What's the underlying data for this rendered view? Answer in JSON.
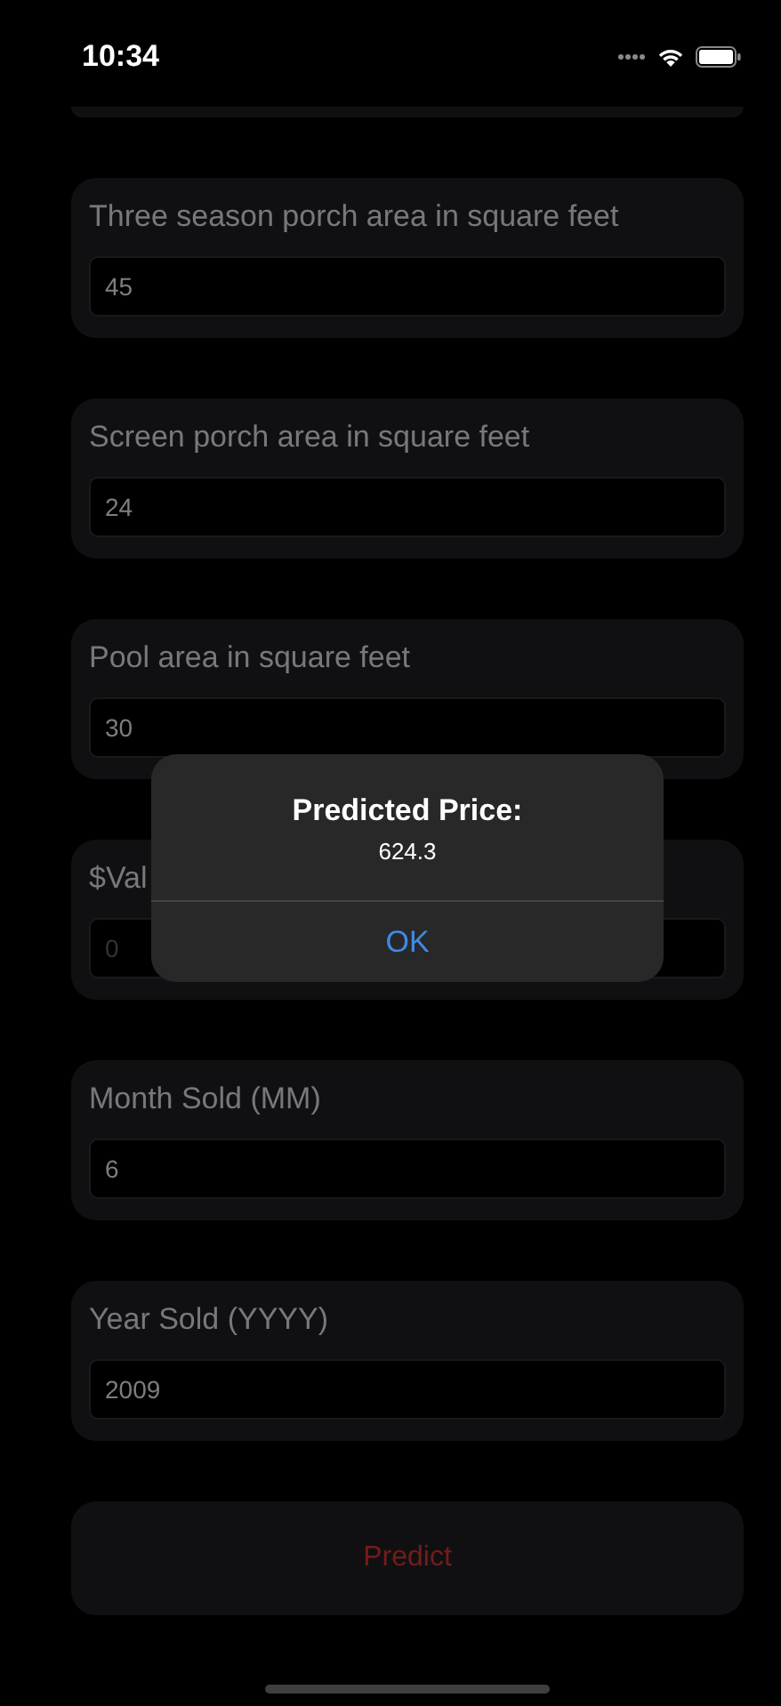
{
  "status_bar": {
    "time": "10:34"
  },
  "fields": [
    {
      "label": "Three season porch area in square feet",
      "value": "45"
    },
    {
      "label": "Screen porch area in square feet",
      "value": "24"
    },
    {
      "label": "Pool area in square feet",
      "value": "30"
    },
    {
      "label": "$Val",
      "placeholder": "0"
    },
    {
      "label": "Month Sold (MM)",
      "value": "6"
    },
    {
      "label": "Year Sold (YYYY)",
      "value": "2009"
    }
  ],
  "predict_button": {
    "label": "Predict"
  },
  "alert": {
    "title": "Predicted Price:",
    "message": "624.3",
    "button": "OK"
  }
}
